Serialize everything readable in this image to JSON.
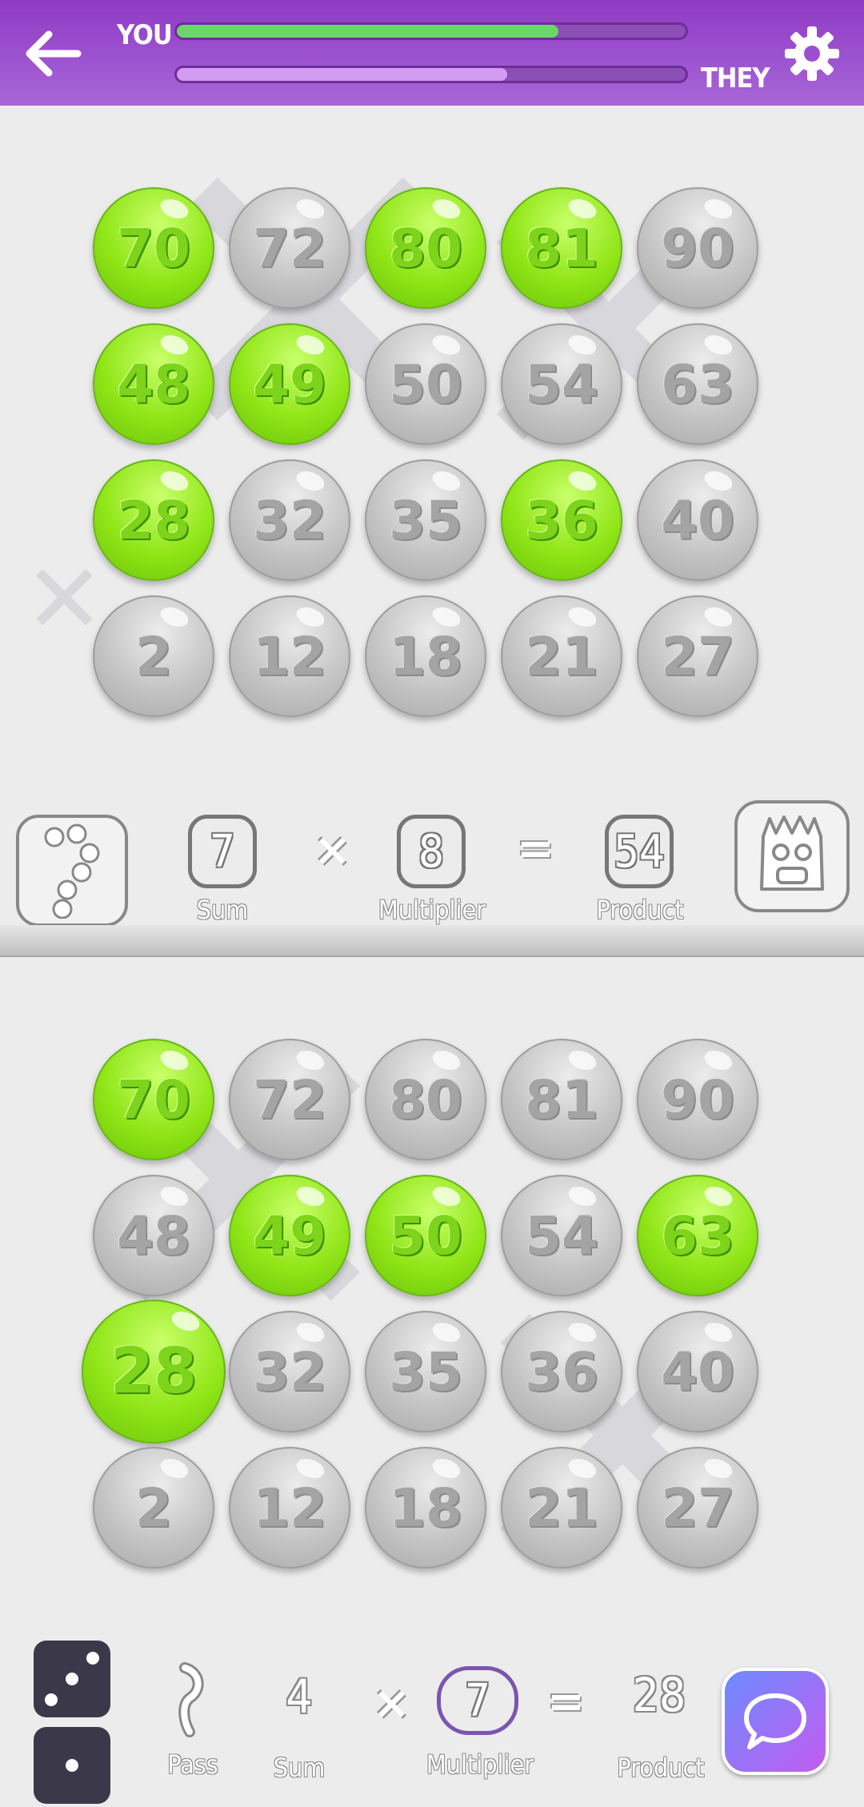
{
  "header": {
    "you_label": "YOU",
    "they_label": "THEY",
    "you_progress": 0.75,
    "they_progress": 0.65,
    "back_icon": "arrow-left-icon",
    "settings_icon": "gear-icon"
  },
  "colors": {
    "header": "#9b4fd0",
    "green": "#8fe516",
    "gray": "#c4c4c4",
    "chat": "#a65bea"
  },
  "opponent": {
    "rows": [
      [
        {
          "n": "70",
          "on": true
        },
        {
          "n": "72",
          "on": false
        },
        {
          "n": "80",
          "on": true
        },
        {
          "n": "81",
          "on": true
        },
        {
          "n": "90",
          "on": false
        }
      ],
      [
        {
          "n": "48",
          "on": true
        },
        {
          "n": "49",
          "on": true
        },
        {
          "n": "50",
          "on": false
        },
        {
          "n": "54",
          "on": false
        },
        {
          "n": "63",
          "on": false
        }
      ],
      [
        {
          "n": "28",
          "on": true
        },
        {
          "n": "32",
          "on": false
        },
        {
          "n": "35",
          "on": false
        },
        {
          "n": "36",
          "on": true
        },
        {
          "n": "40",
          "on": false
        }
      ],
      [
        {
          "n": "2",
          "on": false
        },
        {
          "n": "12",
          "on": false
        },
        {
          "n": "18",
          "on": false
        },
        {
          "n": "21",
          "on": false
        },
        {
          "n": "27",
          "on": false
        }
      ]
    ],
    "sum": "7",
    "sum_label": "Sum",
    "multiplier": "8",
    "multiplier_label": "Multiplier",
    "product": "54",
    "product_label": "Product",
    "times": "×",
    "equals": "="
  },
  "player": {
    "rows": [
      [
        {
          "n": "70",
          "on": true
        },
        {
          "n": "72",
          "on": false
        },
        {
          "n": "80",
          "on": false
        },
        {
          "n": "81",
          "on": false
        },
        {
          "n": "90",
          "on": false
        }
      ],
      [
        {
          "n": "48",
          "on": false
        },
        {
          "n": "49",
          "on": true
        },
        {
          "n": "50",
          "on": true
        },
        {
          "n": "54",
          "on": false
        },
        {
          "n": "63",
          "on": true
        }
      ],
      [
        {
          "n": "28",
          "on": true
        },
        {
          "n": "32",
          "on": false
        },
        {
          "n": "35",
          "on": false
        },
        {
          "n": "36",
          "on": false
        },
        {
          "n": "40",
          "on": false
        }
      ],
      [
        {
          "n": "2",
          "on": false
        },
        {
          "n": "12",
          "on": false
        },
        {
          "n": "18",
          "on": false
        },
        {
          "n": "21",
          "on": false
        },
        {
          "n": "27",
          "on": false
        }
      ]
    ],
    "pass_label": "Pass",
    "sum": "4",
    "sum_label": "Sum",
    "multiplier": "7",
    "multiplier_label": "Multiplier",
    "product": "28",
    "product_label": "Product",
    "times": "×",
    "equals": "=",
    "dice": [
      3,
      1
    ]
  }
}
